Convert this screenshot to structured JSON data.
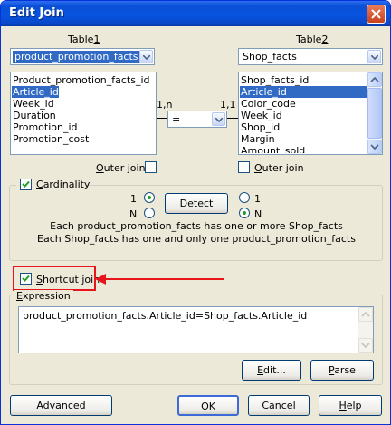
{
  "window": {
    "title": "Edit Join"
  },
  "table1": {
    "label_pre": "Table",
    "label_key": "1",
    "selected": "product_promotion_facts",
    "columns": [
      "Product_promotion_facts_id",
      "Article_id",
      "Week_id",
      "Duration",
      "Promotion_id",
      "Promotion_cost"
    ],
    "selected_column_index": 1,
    "outer_join": {
      "pre": "",
      "key": "O",
      "post": "uter join",
      "checked": false
    }
  },
  "table2": {
    "label_pre": "Table",
    "label_key": "2",
    "selected": "Shop_facts",
    "columns": [
      "Shop_facts_id",
      "Article_id",
      "Color_code",
      "Week_id",
      "Shop_id",
      "Margin",
      "Amount_sold"
    ],
    "selected_column_index": 1,
    "outer_join": {
      "pre": "",
      "key": "O",
      "post": "uter join",
      "checked": false
    }
  },
  "join": {
    "left_cardinality": "1,n",
    "right_cardinality": "1,1",
    "operator": "="
  },
  "cardinality": {
    "pre": "",
    "key": "C",
    "post": "ardinality",
    "checked": true,
    "left_one": "1",
    "left_n": "N",
    "right_one": "1",
    "right_n": "N",
    "left_selected": "1",
    "right_selected": "N",
    "detect_label": "Detect",
    "detect_key": "D",
    "detect_post": "etect",
    "desc_line1": "Each product_promotion_facts has one or more Shop_facts",
    "desc_line2": "Each Shop_facts has one and only one product_promotion_facts"
  },
  "shortcut_join": {
    "pre": "",
    "key": "S",
    "post": "hortcut join",
    "checked": true,
    "highlight_color": "#e8141c"
  },
  "expression": {
    "label_pre": "",
    "label_key": "E",
    "label_post": "xpression",
    "value": "product_promotion_facts.Article_id=Shop_facts.Article_id",
    "edit_label_key": "E",
    "edit_label_post": "dit...",
    "parse_label_key": "P",
    "parse_label_post": "arse"
  },
  "buttons": {
    "advanced": "Advanced",
    "ok": "OK",
    "cancel": "Cancel",
    "help_key": "H",
    "help_post": "elp"
  }
}
